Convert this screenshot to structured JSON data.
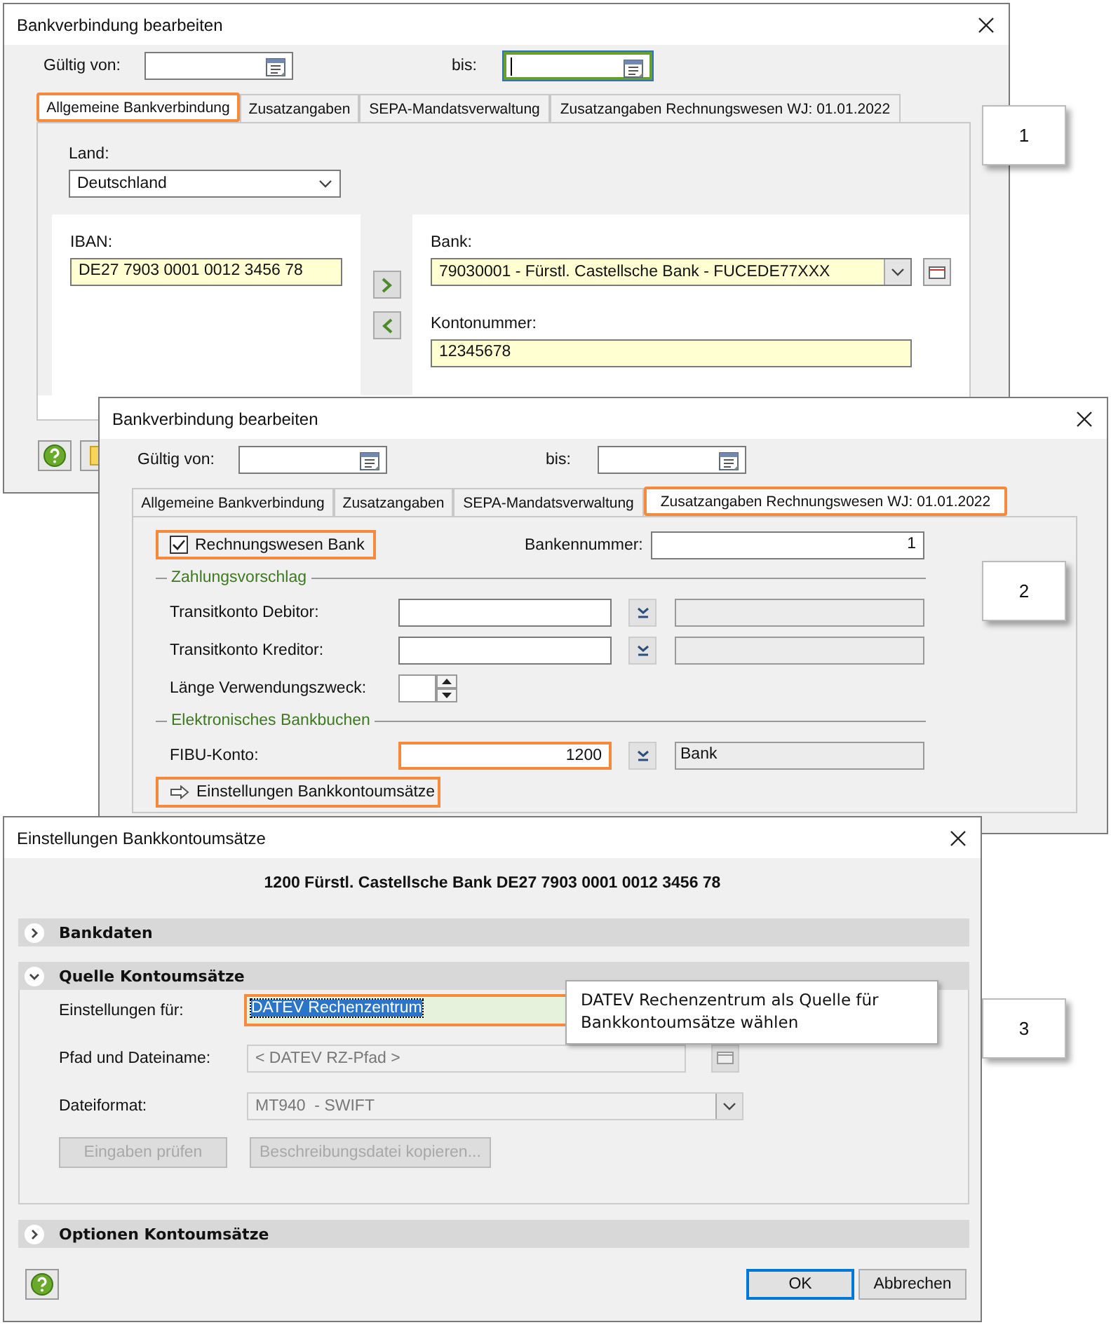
{
  "windows": [
    {
      "kind": "general",
      "title": "Bankverbindung bearbeiten",
      "valid_from": {
        "label": "Gültig von:"
      },
      "valid_to": {
        "label": "bis:",
        "focused": true
      },
      "tabs": [
        {
          "label": "Allgemeine Bankverbindung",
          "selected": true
        },
        {
          "label": "Zusatzangaben",
          "selected": false
        },
        {
          "label": "SEPA-Mandatsverwaltung",
          "selected": false
        },
        {
          "label": "Zusatzangaben Rechnungswesen WJ: 01.01.2022",
          "selected": false
        }
      ],
      "country": {
        "label": "Land:",
        "value": "Deutschland"
      },
      "iban": {
        "label": "IBAN:",
        "value": "DE27 7903 0001 0012 3456 78"
      },
      "bank": {
        "label": "Bank:",
        "value": "79030001 - Fürstl. Castellsche Bank - FUCEDE77XXX"
      },
      "account": {
        "label": "Kontonummer:",
        "value": "12345678"
      }
    },
    {
      "kind": "accounting",
      "title": "Bankverbindung bearbeiten",
      "valid_from": {
        "label": "Gültig von:"
      },
      "valid_to": {
        "label": "bis:",
        "focused": false
      },
      "tabs": [
        {
          "label": "Allgemeine Bankverbindung",
          "selected": false
        },
        {
          "label": "Zusatzangaben",
          "selected": false
        },
        {
          "label": "SEPA-Mandatsverwaltung",
          "selected": false
        },
        {
          "label": "Zusatzangaben Rechnungswesen WJ: 01.01.2022",
          "selected": true
        }
      ],
      "accounting_bank": {
        "label": "Rechnungswesen Bank",
        "checked": true,
        "highlighted": true
      },
      "bank_number": {
        "label": "Bankennummer:",
        "value": "1"
      },
      "groups": [
        {
          "title": "Zahlungsvorschlag",
          "rows": [
            {
              "kind": "lookup",
              "label": "Transitkonto Debitor:"
            },
            {
              "kind": "lookup",
              "label": "Transitkonto Kreditor:"
            },
            {
              "kind": "spinner",
              "label": "Länge Verwendungszweck:"
            }
          ]
        },
        {
          "title": "Elektronisches Bankbuchen",
          "rows": [
            {
              "kind": "lookup",
              "label": "FIBU-Konto:",
              "value": "1200",
              "name": "Bank",
              "highlighted": true
            }
          ]
        }
      ],
      "link": {
        "label": "Einstellungen Bankkontoumsätze",
        "highlighted": true
      }
    },
    {
      "kind": "statements",
      "title": "Einstellungen Bankkontoumsätze",
      "heading": "1200 Fürstl. Castellsche Bank DE27 7903 0001 0012 3456 78",
      "sections": [
        {
          "title": "Bankdaten",
          "expanded": false
        },
        {
          "title": "Quelle Kontoumsätze",
          "expanded": true,
          "fields": [
            {
              "kind": "select",
              "label": "Einstellungen für:",
              "value": "DATEV Rechenzentrum",
              "highlighted": true
            },
            {
              "kind": "path",
              "label": "Pfad und Dateiname:",
              "value": "< DATEV RZ-Pfad >",
              "disabled": true
            },
            {
              "kind": "select",
              "label": "Dateiformat:",
              "value": "MT940  - SWIFT",
              "disabled": true
            }
          ],
          "buttons": [
            {
              "label": "Eingaben prüfen",
              "disabled": true
            },
            {
              "label": "Beschreibungsdatei kopieren...",
              "disabled": true
            }
          ]
        },
        {
          "title": "Optionen Kontoumsätze",
          "expanded": false
        }
      ],
      "tooltip": "DATEV Rechenzentrum als Quelle für Bankkontoumsätze wählen",
      "buttons": [
        {
          "label": "OK",
          "default": true
        },
        {
          "label": "Abbrechen",
          "default": false
        }
      ]
    }
  ],
  "callouts": [
    "1",
    "2",
    "3"
  ]
}
